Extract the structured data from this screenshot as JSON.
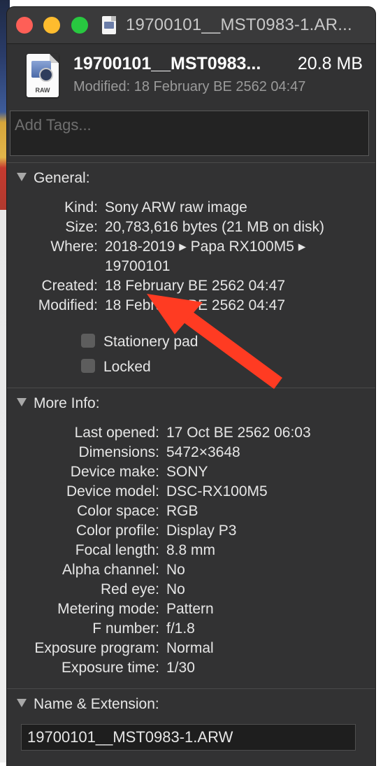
{
  "window": {
    "title": "19700101__MST0983-1.AR..."
  },
  "header": {
    "file_name": "19700101__MST0983...",
    "file_size": "20.8 MB",
    "modified": "Modified: 18 February BE 2562 04:47",
    "icon_label": "RAW"
  },
  "tags": {
    "placeholder": "Add Tags..."
  },
  "general": {
    "title": "General:",
    "rows": [
      {
        "label": "Kind:",
        "value": "Sony ARW raw image"
      },
      {
        "label": "Size:",
        "value": "20,783,616 bytes (21 MB on disk)"
      },
      {
        "label": "Where:",
        "value": "2018-2019 ▸ Papa RX100M5 ▸",
        "value2": "19700101"
      },
      {
        "label": "Created:",
        "value": "18 February BE 2562 04:47"
      },
      {
        "label": "Modified:",
        "value": "18 February BE 2562 04:47"
      }
    ],
    "stationery_label": "Stationery pad",
    "locked_label": "Locked"
  },
  "more_info": {
    "title": "More Info:",
    "rows": [
      {
        "label": "Last opened:",
        "value": "17 Oct BE 2562 06:03"
      },
      {
        "label": "Dimensions:",
        "value": "5472×3648"
      },
      {
        "label": "Device make:",
        "value": "SONY"
      },
      {
        "label": "Device model:",
        "value": "DSC-RX100M5"
      },
      {
        "label": "Color space:",
        "value": "RGB"
      },
      {
        "label": "Color profile:",
        "value": "Display P3"
      },
      {
        "label": "Focal length:",
        "value": "8.8 mm"
      },
      {
        "label": "Alpha channel:",
        "value": "No"
      },
      {
        "label": "Red eye:",
        "value": "No"
      },
      {
        "label": "Metering mode:",
        "value": "Pattern"
      },
      {
        "label": "F number:",
        "value": "f/1.8"
      },
      {
        "label": "Exposure program:",
        "value": "Normal"
      },
      {
        "label": "Exposure time:",
        "value": "1/30"
      }
    ]
  },
  "name_extension": {
    "title": "Name & Extension:",
    "value": "19700101__MST0983-1.ARW"
  },
  "annotation": {
    "arrow_color": "#ff3b22"
  }
}
